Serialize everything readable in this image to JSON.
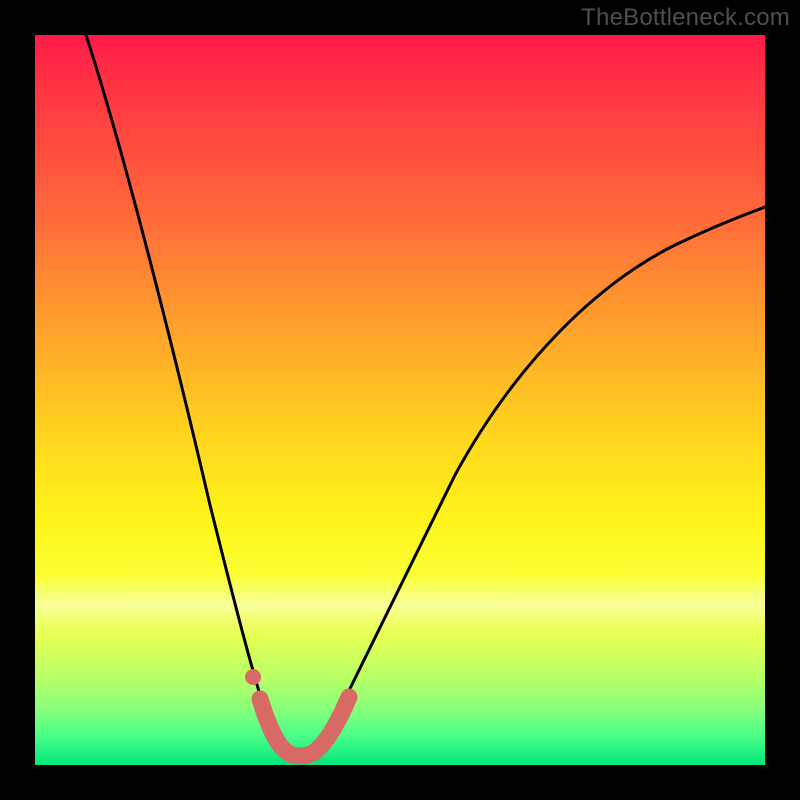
{
  "watermark": "TheBottleneck.com",
  "chart_data": {
    "type": "line",
    "title": "",
    "xlabel": "",
    "ylabel": "",
    "xlim": [
      0,
      100
    ],
    "ylim": [
      0,
      100
    ],
    "grid": false,
    "legend": false,
    "series": [
      {
        "name": "bottleneck-curve",
        "x": [
          7,
          10,
          14,
          18,
          22,
          26,
          29,
          31,
          32,
          34,
          36,
          38,
          40,
          43,
          47,
          53,
          60,
          68,
          76,
          85,
          93,
          100
        ],
        "y": [
          100,
          89,
          75,
          60,
          45,
          30,
          18,
          12,
          8,
          4,
          2,
          2,
          4,
          8,
          15,
          25,
          37,
          48,
          57,
          65,
          71,
          75
        ]
      },
      {
        "name": "highlight-segment",
        "x": [
          30,
          31,
          32,
          34,
          36,
          38,
          40,
          42,
          44
        ],
        "y": [
          14,
          10.5,
          7,
          3,
          2,
          2,
          3.5,
          6.5,
          10
        ]
      },
      {
        "name": "highlight-dot",
        "x": [
          30
        ],
        "y": [
          14
        ]
      }
    ],
    "colors": {
      "curve": "#000000",
      "highlight": "#d86a66",
      "gradient_top": "#ff1a49",
      "gradient_bottom": "#00e77a"
    }
  }
}
